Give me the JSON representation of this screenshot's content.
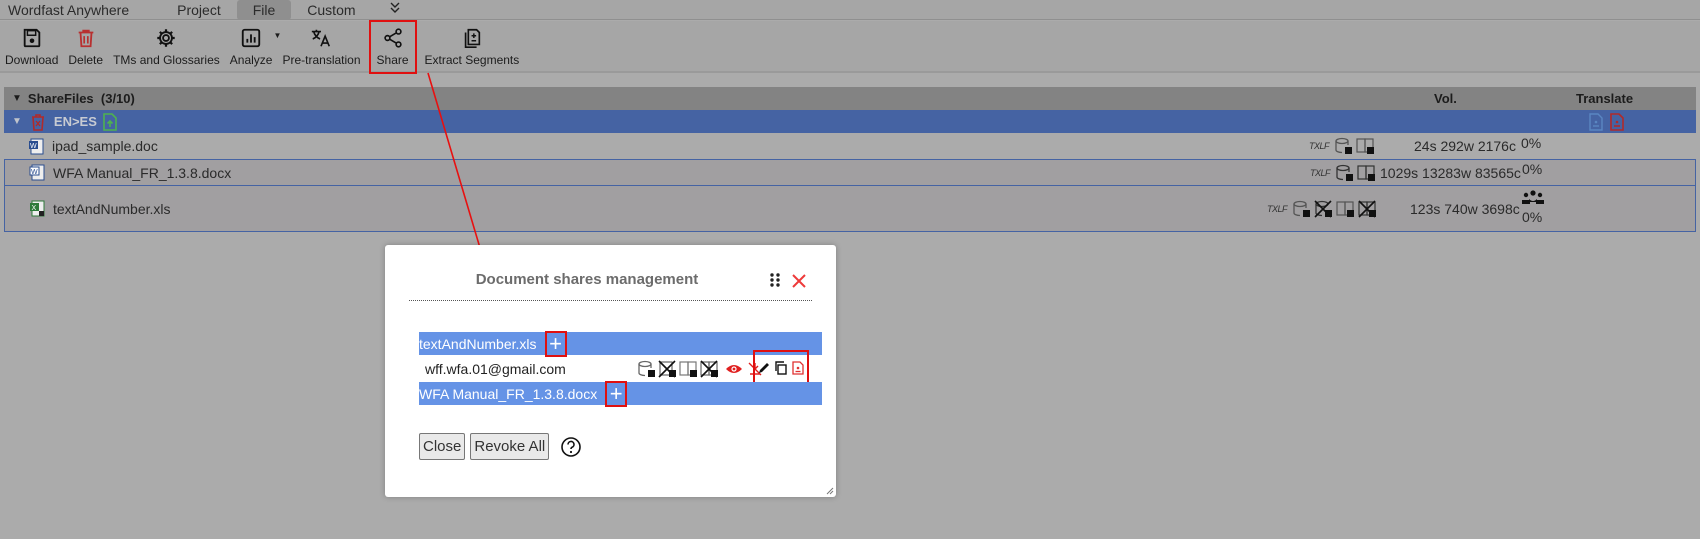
{
  "menubar": {
    "items": [
      "Wordfast Anywhere",
      "Project",
      "File",
      "Custom"
    ],
    "active": "File",
    "more_icon": "double-chevron-down-icon"
  },
  "toolbar": {
    "buttons": [
      {
        "label": "Download",
        "icon": "floppy-disk-icon"
      },
      {
        "label": "Delete",
        "icon": "trash-icon"
      },
      {
        "label": "TMs and Glossaries",
        "icon": "gear-icon"
      },
      {
        "label": "Analyze",
        "icon": "bar-chart-icon"
      },
      {
        "label": "Pre-translation",
        "icon": "translate-icon"
      },
      {
        "label": "Share",
        "icon": "share-icon"
      },
      {
        "label": "Extract Segments",
        "icon": "extract-icon"
      }
    ]
  },
  "grid": {
    "title": "ShareFiles  (3/10)",
    "vol_header": "Vol.",
    "translate_header": "Translate",
    "group": {
      "label": "EN>ES"
    },
    "files": [
      {
        "name": "ipad_sample.doc",
        "format": "TXLF",
        "volume": "24s 292w 2176c",
        "progress": "0%",
        "type": "word"
      },
      {
        "name": "WFA Manual_FR_1.3.8.docx",
        "format": "TXLF",
        "volume": "1029s 13283w 83565c",
        "progress": "0%",
        "type": "word"
      },
      {
        "name": "textAndNumber.xls",
        "format": "TXLF",
        "volume": "123s 740w 3698c",
        "progress": "0%",
        "type": "excel",
        "shared": true
      }
    ]
  },
  "dialog": {
    "title": "Document shares management",
    "documents": [
      {
        "name": "textAndNumber.xls",
        "shares": [
          {
            "email": "wff.wfa.01@gmail.com"
          }
        ]
      },
      {
        "name": "WFA Manual_FR_1.3.8.docx",
        "shares": []
      }
    ],
    "add_symbol": "+",
    "close_label": "Close",
    "revoke_all_label": "Revoke All"
  },
  "colors": {
    "accent_red": "#e01010",
    "group_blue": "#4563a3",
    "dialog_bar_blue": "#6593e6"
  }
}
